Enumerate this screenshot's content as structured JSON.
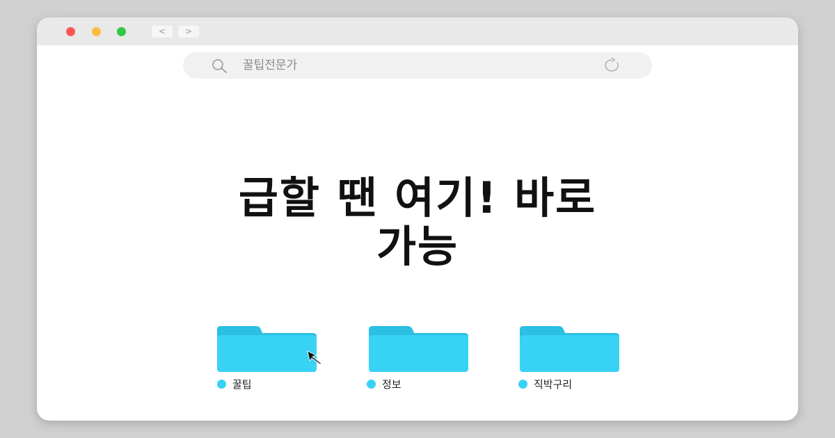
{
  "window": {
    "controls": {
      "close_color": "#fc5753",
      "minimize_color": "#fdbc40",
      "zoom_color": "#33c748"
    },
    "nav": {
      "back_label": "<",
      "forward_label": ">"
    }
  },
  "search": {
    "icon": "search-icon",
    "query": "꿀팁전문가",
    "reload_icon": "reload-icon"
  },
  "headline": {
    "line1": "급할 땐 여기! 바로",
    "line2": "가능"
  },
  "folders": [
    {
      "label": "꿀팁",
      "color": "#38d2f5"
    },
    {
      "label": "정보",
      "color": "#38d2f5"
    },
    {
      "label": "직박구리",
      "color": "#38d2f5"
    }
  ],
  "cursor_icon": "mouse-pointer-icon"
}
